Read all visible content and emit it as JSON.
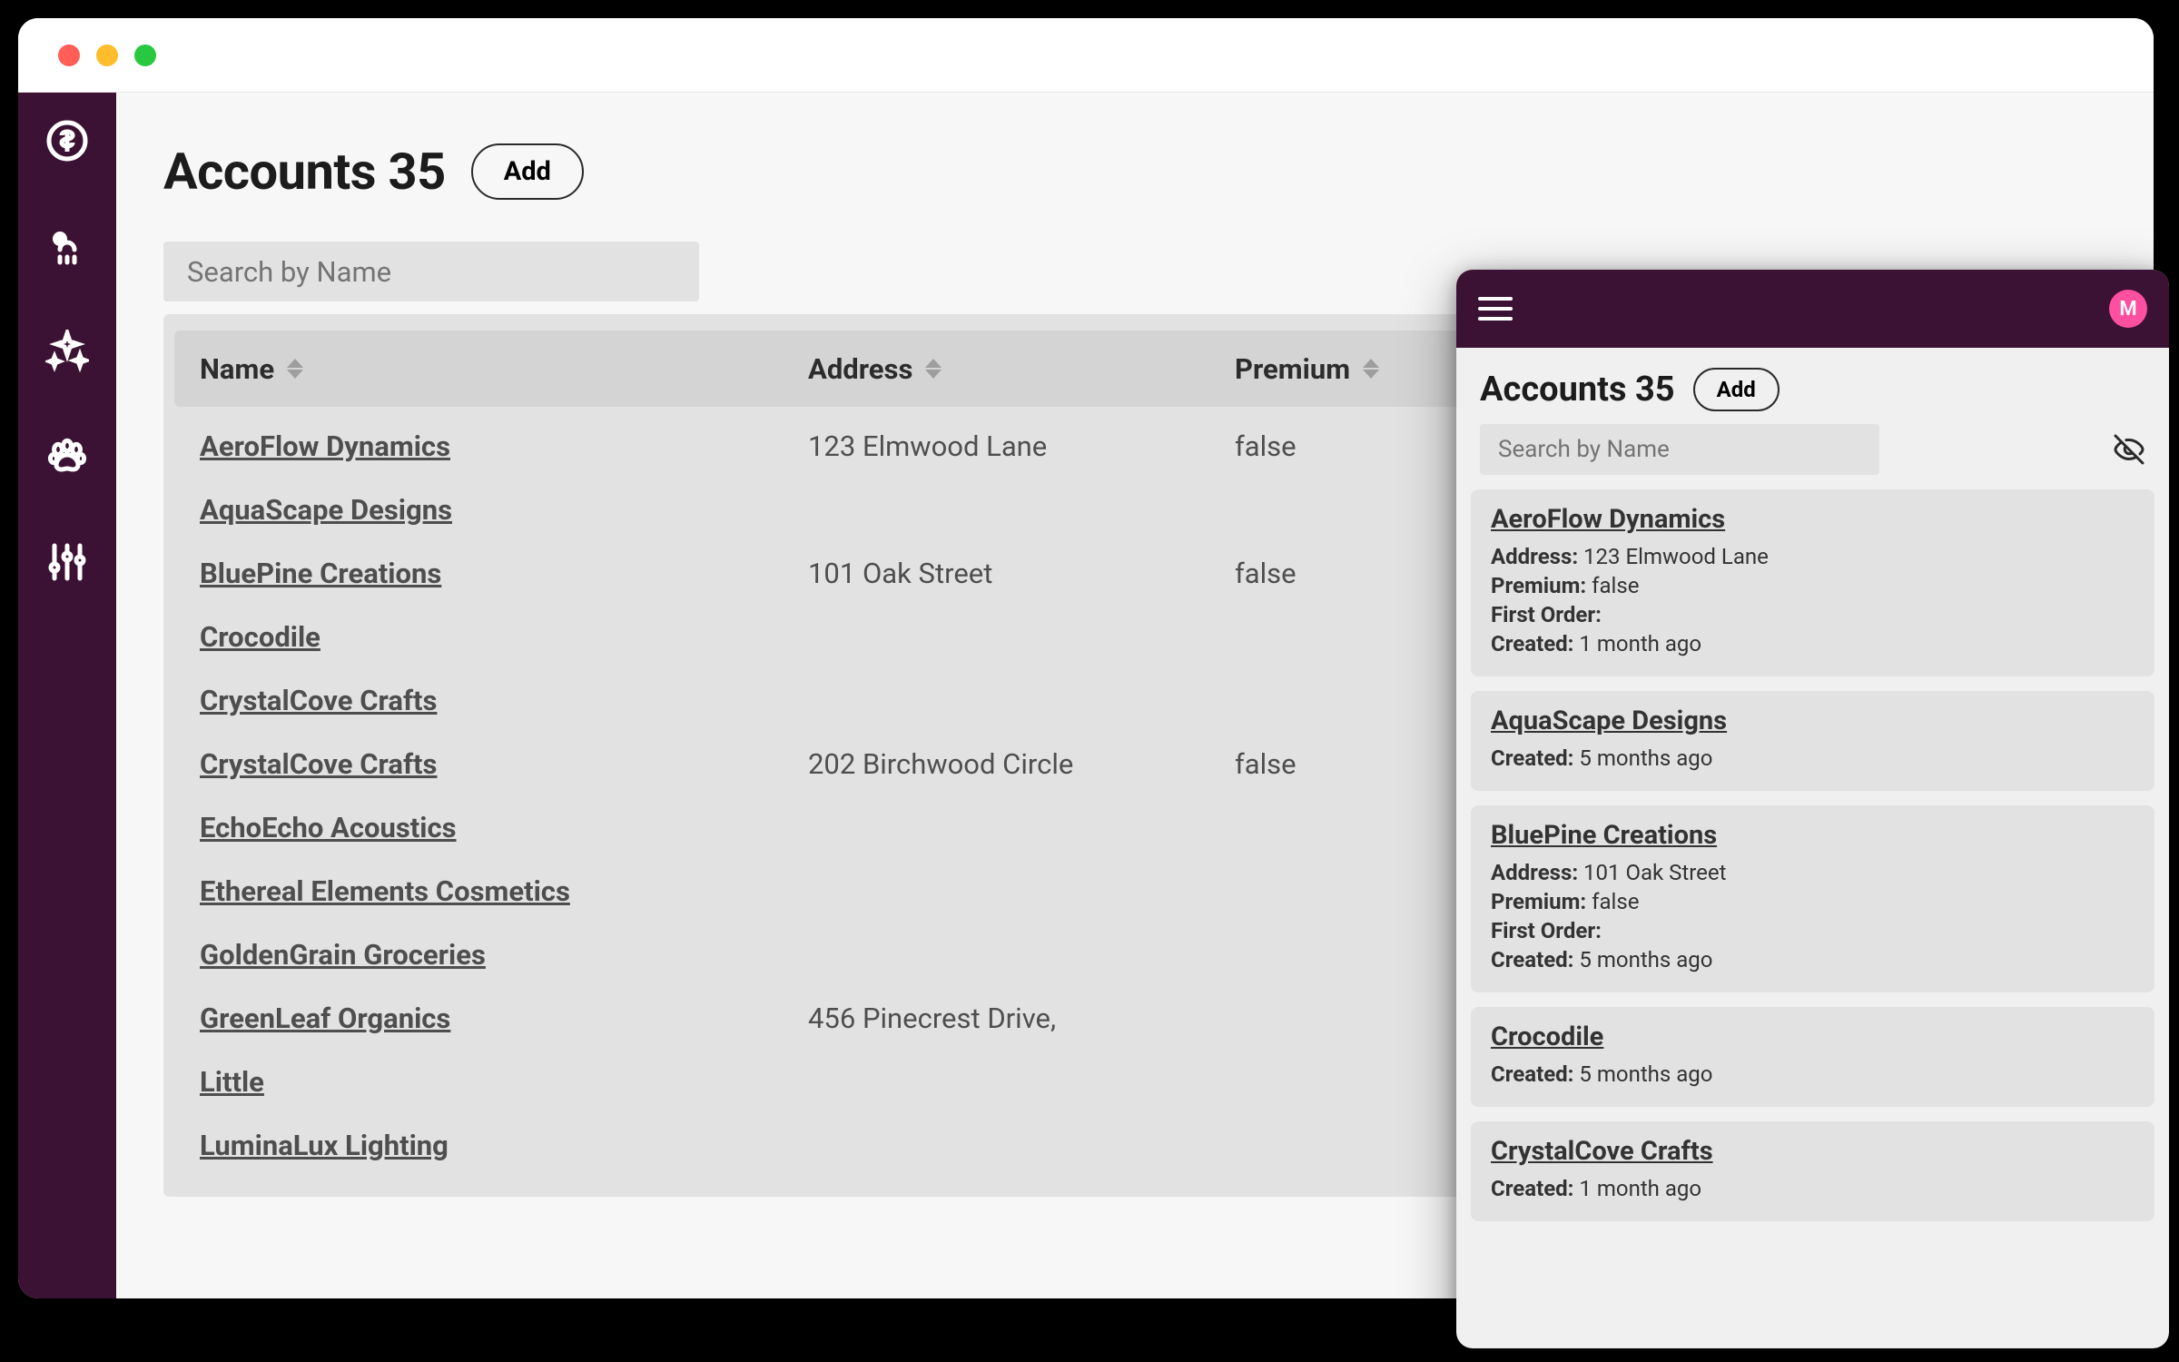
{
  "header": {
    "title_prefix": "Accounts",
    "count": "35",
    "add_label": "Add",
    "search_placeholder": "Search by Name"
  },
  "columns": {
    "name": "Name",
    "address": "Address",
    "premium": "Premium"
  },
  "rows": [
    {
      "name": "AeroFlow Dynamics",
      "address": "123 Elmwood Lane",
      "premium": "false"
    },
    {
      "name": "AquaScape Designs",
      "address": "",
      "premium": ""
    },
    {
      "name": "BluePine Creations",
      "address": "101 Oak Street",
      "premium": "false"
    },
    {
      "name": "Crocodile",
      "address": "",
      "premium": ""
    },
    {
      "name": "CrystalCove Crafts",
      "address": "",
      "premium": ""
    },
    {
      "name": "CrystalCove Crafts",
      "address": "202 Birchwood Circle",
      "premium": "false"
    },
    {
      "name": "EchoEcho Acoustics",
      "address": "",
      "premium": ""
    },
    {
      "name": "Ethereal Elements Cosmetics",
      "address": "",
      "premium": ""
    },
    {
      "name": "GoldenGrain Groceries",
      "address": "",
      "premium": ""
    },
    {
      "name": "GreenLeaf Organics",
      "address": "456 Pinecrest Drive,",
      "premium": ""
    },
    {
      "name": "Little",
      "address": "",
      "premium": ""
    },
    {
      "name": "LuminaLux Lighting",
      "address": "",
      "premium": ""
    }
  ],
  "mobile": {
    "avatar_initial": "M",
    "title_prefix": "Accounts",
    "count": "35",
    "add_label": "Add",
    "search_placeholder": "Search by Name",
    "labels": {
      "address": "Address:",
      "premium": "Premium:",
      "first_order": "First Order:",
      "created": "Created:"
    },
    "cards": [
      {
        "name": "AeroFlow Dynamics",
        "address": "123 Elmwood Lane",
        "premium": "false",
        "first_order": "",
        "created": "1 month ago"
      },
      {
        "name": "AquaScape Designs",
        "created": "5 months ago"
      },
      {
        "name": "BluePine Creations",
        "address": "101 Oak Street",
        "premium": "false",
        "first_order": "",
        "created": "5 months ago"
      },
      {
        "name": "Crocodile",
        "created": "5 months ago"
      },
      {
        "name": "CrystalCove Crafts",
        "created": "1 month ago"
      }
    ]
  }
}
